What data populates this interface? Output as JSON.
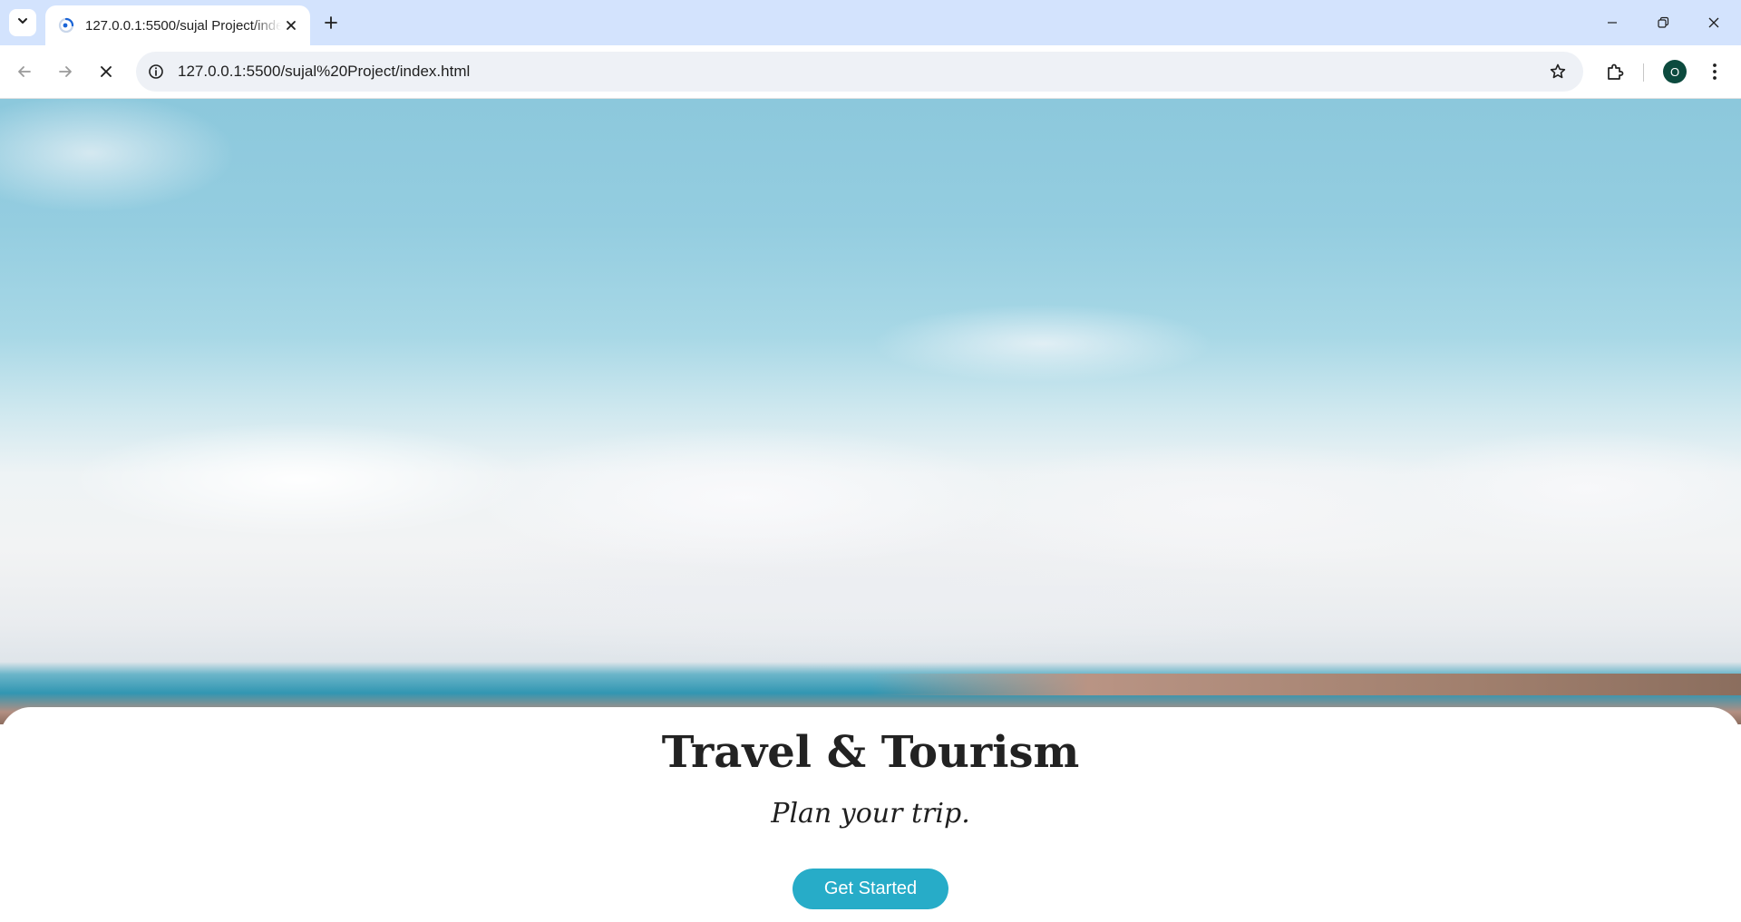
{
  "browser": {
    "tab_title": "127.0.0.1:5500/sujal Project/index.html",
    "url": "127.0.0.1:5500/sujal%20Project/index.html",
    "profile_initial": "O",
    "icons": {
      "tab_search": "chevron-down-icon",
      "favicon": "loading-spinner-icon",
      "tab_close": "close-icon",
      "new_tab": "plus-icon",
      "minimize": "minimize-icon",
      "restore": "restore-icon",
      "close_window": "close-icon",
      "back": "arrow-left-icon",
      "forward": "arrow-right-icon",
      "stop": "close-icon",
      "site_info": "info-icon",
      "bookmark": "star-icon",
      "extensions": "puzzle-icon",
      "menu": "kebab-menu-icon"
    }
  },
  "page": {
    "title": "Travel & Tourism",
    "subtitle": "Plan your trip.",
    "cta_label": "Get Started",
    "accent_color": "#27acc8"
  }
}
